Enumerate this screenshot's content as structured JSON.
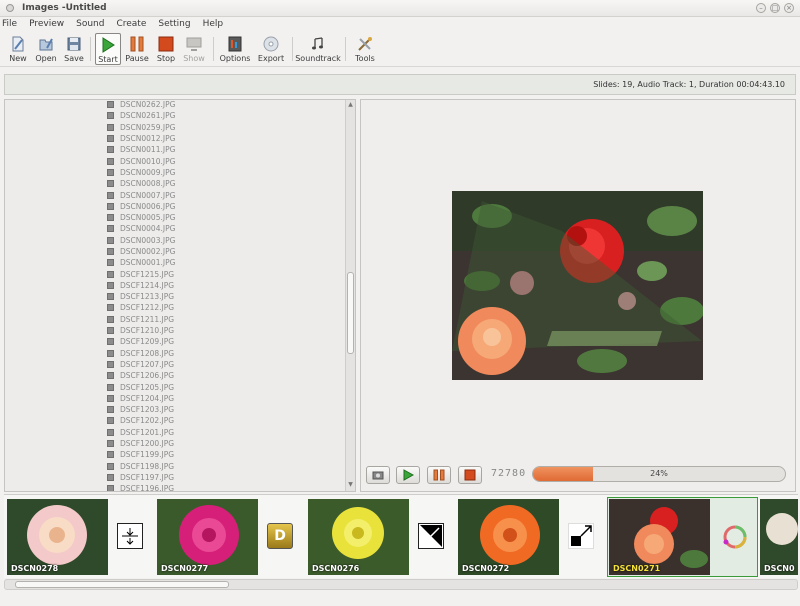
{
  "window": {
    "title": "Images -Untitled"
  },
  "menu": [
    "File",
    "Preview",
    "Sound",
    "Create",
    "Setting",
    "Help"
  ],
  "toolbar": {
    "new": "New",
    "open": "Open",
    "save": "Save",
    "start": "Start",
    "pause": "Pause",
    "stop": "Stop",
    "show": "Show",
    "options": "Options",
    "export": "Export",
    "soundtrack": "Soundtrack",
    "tools": "Tools"
  },
  "status": "Slides: 19, Audio Track: 1, Duration 00:04:43.10",
  "files": [
    "DSCN0262.JPG",
    "DSCN0261.JPG",
    "DSCN0259.JPG",
    "DSCN0012.JPG",
    "DSCN0011.JPG",
    "DSCN0010.JPG",
    "DSCN0009.JPG",
    "DSCN0008.JPG",
    "DSCN0007.JPG",
    "DSCN0006.JPG",
    "DSCN0005.JPG",
    "DSCN0004.JPG",
    "DSCN0003.JPG",
    "DSCN0002.JPG",
    "DSCN0001.JPG",
    "DSCF1215.JPG",
    "DSCF1214.JPG",
    "DSCF1213.JPG",
    "DSCF1212.JPG",
    "DSCF1211.JPG",
    "DSCF1210.JPG",
    "DSCF1209.JPG",
    "DSCF1208.JPG",
    "DSCF1207.JPG",
    "DSCF1206.JPG",
    "DSCF1205.JPG",
    "DSCF1204.JPG",
    "DSCF1203.JPG",
    "DSCF1202.JPG",
    "DSCF1201.JPG",
    "DSCF1200.JPG",
    "DSCF1199.JPG",
    "DSCF1198.JPG",
    "DSCF1197.JPG",
    "DSCF1196.JPG"
  ],
  "player": {
    "counter": "72780",
    "progress_fraction": 0.24,
    "progress_label": "24%"
  },
  "timeline": [
    {
      "label": "DSCN0278",
      "selected": false
    },
    {
      "label": "DSCN0277",
      "selected": false
    },
    {
      "label": "DSCN0276",
      "selected": false
    },
    {
      "label": "DSCN0272",
      "selected": false
    },
    {
      "label": "DSCN0271",
      "selected": true
    },
    {
      "label": "DSCN0",
      "selected": false
    }
  ],
  "transitions": {
    "t1": "D"
  },
  "colors": {
    "accent": "#e06a34",
    "play": "#3aa63a",
    "stop": "#d24a1e",
    "selected_label": "#f5e33a"
  }
}
